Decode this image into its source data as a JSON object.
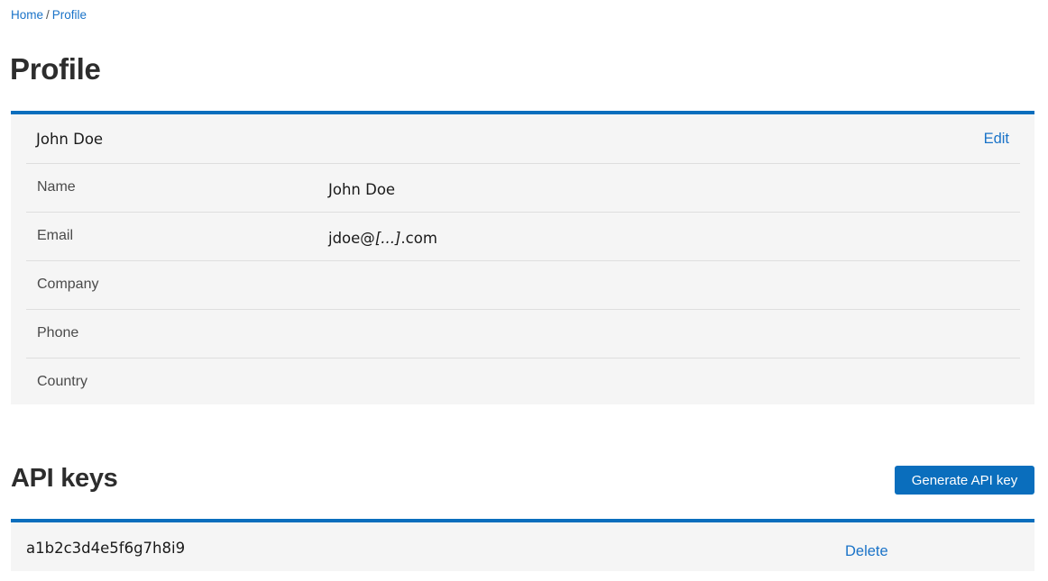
{
  "breadcrumb": {
    "home": "Home",
    "separator": "/",
    "current": "Profile"
  },
  "page": {
    "title": "Profile"
  },
  "profile": {
    "header_name": "John Doe",
    "edit_label": "Edit",
    "fields": [
      {
        "label": "Name",
        "value": "John Doe"
      },
      {
        "label": "Email",
        "value_prefix": "jdoe@",
        "value_redacted": "[...]",
        "value_suffix": ".com"
      },
      {
        "label": "Company",
        "value": ""
      },
      {
        "label": "Phone",
        "value": ""
      },
      {
        "label": "Country",
        "value": ""
      }
    ]
  },
  "api_keys": {
    "title": "API keys",
    "generate_label": "Generate API key",
    "keys": [
      {
        "value": "a1b2c3d4e5f6g7h8i9",
        "delete_label": "Delete"
      }
    ]
  },
  "colors": {
    "accent": "#0a6ebd",
    "link": "#1a73c8",
    "card_background": "#f5f5f5"
  }
}
